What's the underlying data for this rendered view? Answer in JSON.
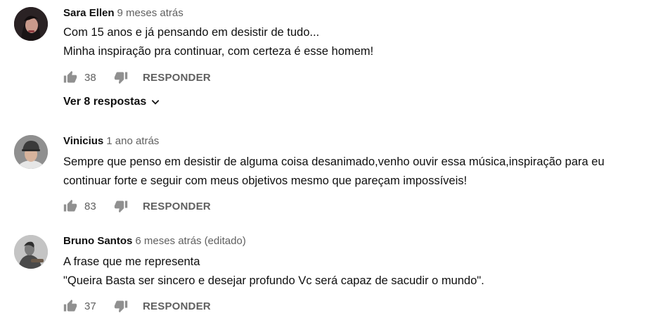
{
  "colors": {
    "text": "#0f0f0f",
    "secondary": "#606060",
    "icon": "#909090"
  },
  "comments": [
    {
      "author": "Sara Ellen",
      "time": "9 meses atrás",
      "edited": "",
      "lines": [
        "Com 15 anos e já pensando em desistir de tudo...",
        "Minha inspiração pra continuar, com certeza é esse homem!"
      ],
      "likes": "38",
      "reply_label": "RESPONDER",
      "replies_label": "Ver 8 respostas"
    },
    {
      "author": "Vinicius",
      "time": "1 ano atrás",
      "edited": "",
      "lines": [
        "Sempre que penso em desistir de alguma coisa desanimado,venho ouvir essa música,inspiração para eu",
        "continuar forte e seguir com meus objetivos mesmo que pareçam impossíveis!"
      ],
      "likes": "83",
      "reply_label": "RESPONDER"
    },
    {
      "author": "Bruno Santos",
      "time": "6 meses atrás",
      "edited": "(editado)",
      "lines": [
        "A frase que me representa",
        "\"Queira Basta ser sincero e desejar profundo Vc será capaz de sacudir o mundo\"."
      ],
      "likes": "37",
      "reply_label": "RESPONDER"
    }
  ],
  "icons": {
    "like": "thumb-up-icon",
    "dislike": "thumb-down-icon",
    "expand": "chevron-down-icon"
  }
}
